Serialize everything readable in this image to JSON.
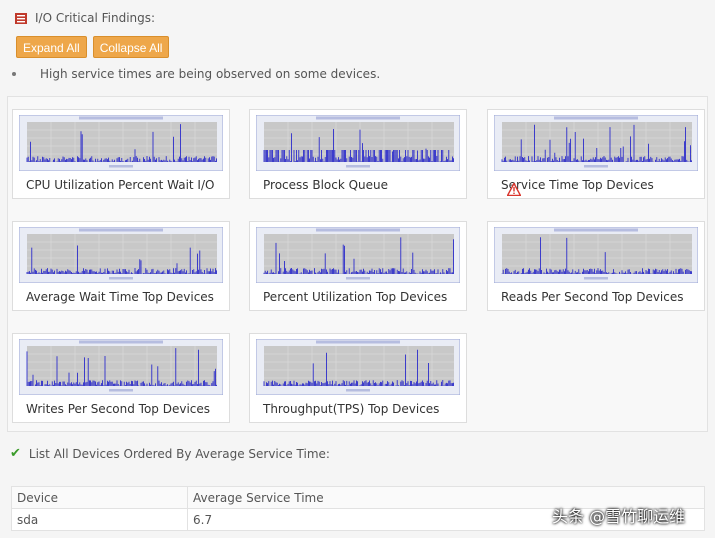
{
  "header": {
    "title": "I/O Critical Findings:",
    "icon": "report-icon",
    "icon_color": "#c0392b"
  },
  "toolbar": {
    "expand_label": "Expand All",
    "collapse_label": "Collapse All",
    "button_color": "#eea74a"
  },
  "finding": {
    "text": "High service times are being observed on some devices."
  },
  "charts": [
    {
      "caption": "CPU Utilization Percent Wait I/O",
      "warning": false
    },
    {
      "caption": "Process Block Queue",
      "warning": false
    },
    {
      "caption": "Service Time Top Devices",
      "warning": true
    },
    {
      "caption": "Average Wait Time Top Devices",
      "warning": false
    },
    {
      "caption": "Percent Utilization Top Devices",
      "warning": false
    },
    {
      "caption": "Reads Per Second Top Devices",
      "warning": false
    },
    {
      "caption": "Writes Per Second Top Devices",
      "warning": false
    },
    {
      "caption": "Throughput(TPS) Top Devices",
      "warning": false
    }
  ],
  "device_list": {
    "label": "List All Devices Ordered By Average Service Time:",
    "columns": [
      "Device",
      "Average Service Time"
    ],
    "rows": [
      [
        "sda",
        "6.7"
      ]
    ]
  },
  "watermark": "头条 @雪竹聊运维",
  "colors": {
    "plot_bg": "#c8c8c8",
    "plot_frame": "#9aa6d6",
    "series": "#1a1acc",
    "warning": "#d9342b",
    "check": "#3a9b2a"
  }
}
